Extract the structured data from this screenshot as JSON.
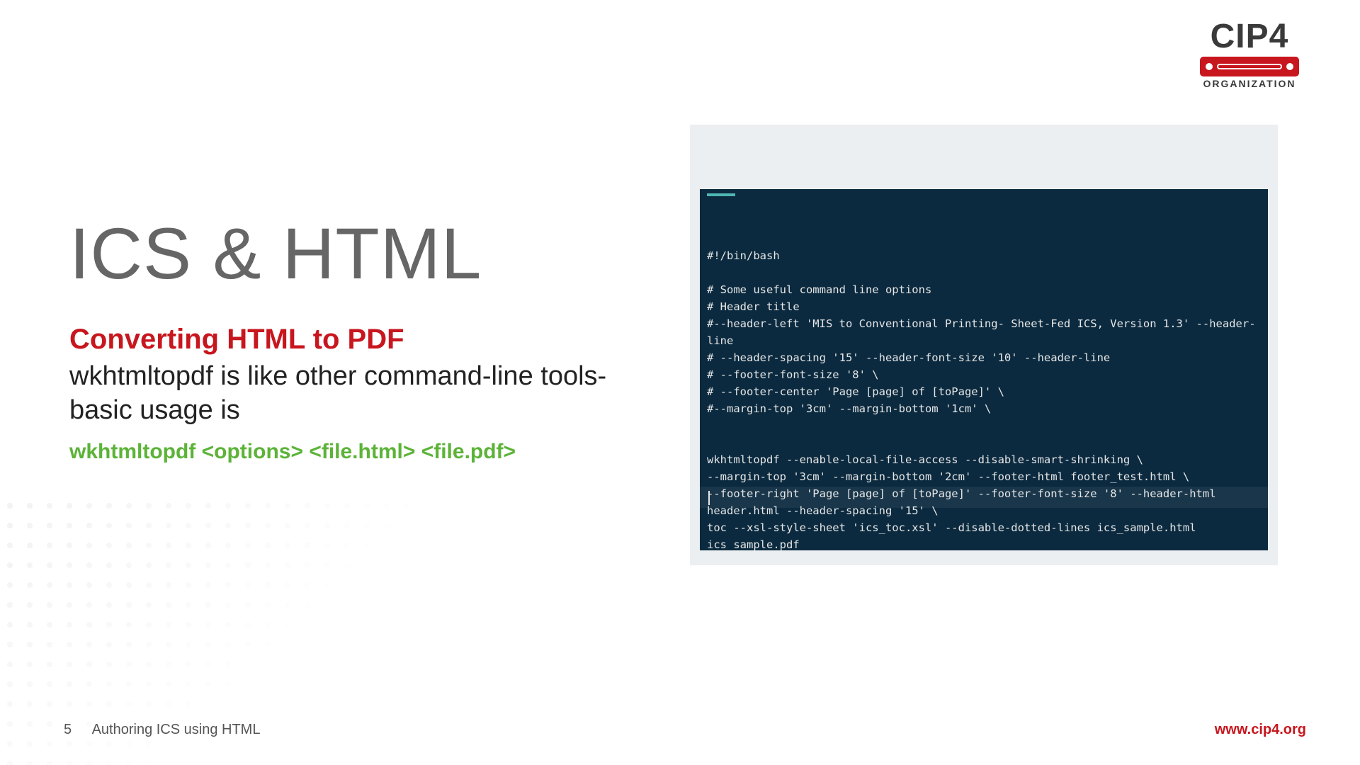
{
  "logo": {
    "text": "CIP4",
    "sub": "ORGANIZATION"
  },
  "title": "ICS & HTML",
  "subtitle": "Converting HTML to PDF",
  "body": "wkhtmltopdf is like other command-line tools- basic usage is",
  "command": "wkhtmltopdf <options> <file.html> <file.pdf>",
  "terminal": {
    "lines": [
      "#!/bin/bash",
      "",
      "# Some useful command line options",
      "# Header title",
      "#--header-left 'MIS to Conventional Printing- Sheet-Fed ICS, Version 1.3' --header-line",
      "# --header-spacing '15' --header-font-size '10' --header-line",
      "# --footer-font-size '8' \\",
      "# --footer-center 'Page [page] of [toPage]' \\",
      "#--margin-top '3cm' --margin-bottom '1cm' \\",
      "",
      "",
      "wkhtmltopdf --enable-local-file-access --disable-smart-shrinking \\",
      "--margin-top '3cm' --margin-bottom '2cm' --footer-html footer_test.html \\",
      "--footer-right 'Page [page] of [toPage]' --footer-font-size '8' --header-html header.html --header-spacing '15' \\",
      "toc --xsl-style-sheet 'ics_toc.xsl' --disable-dotted-lines ics_sample.html ics_sample.pdf"
    ]
  },
  "footer": {
    "page": "5",
    "title": "Authoring ICS using HTML",
    "url": "www.cip4.org"
  }
}
